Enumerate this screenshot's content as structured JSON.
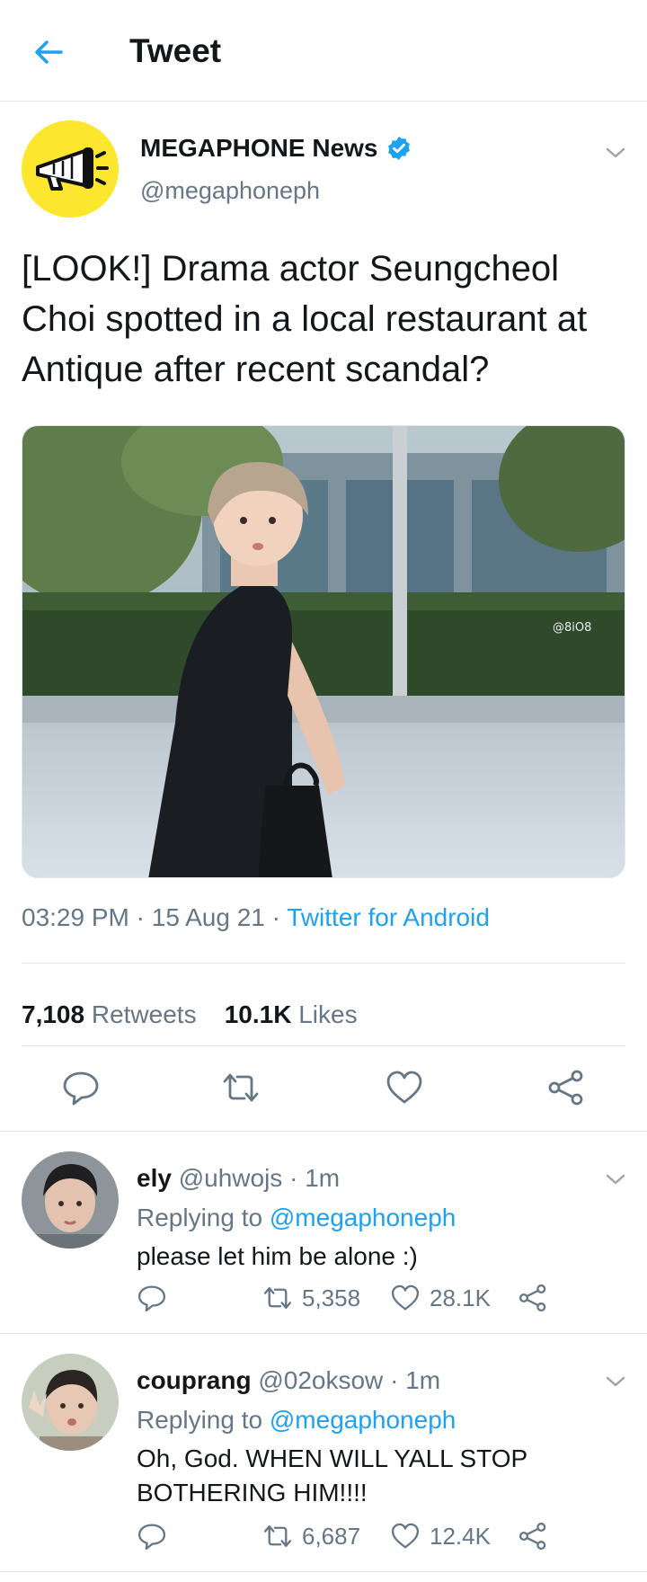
{
  "header": {
    "title": "Tweet",
    "back_icon": "arrow-left-icon"
  },
  "colors": {
    "accent": "#1da1f2",
    "muted": "#657786",
    "text": "#14171a",
    "avatar_bg": "#fde72e"
  },
  "tweet": {
    "author_name": "MEGAPHONE News",
    "author_handle": "@megaphoneph",
    "text": "[LOOK!] Drama actor Seungcheol Choi spotted in a local restaurant at Antique after recent scandal?",
    "media_watermark": "@8iO8",
    "time": "03:29 PM",
    "date": "15 Aug 21",
    "source": "Twitter for Android",
    "retweets_count": "7,108",
    "retweets_label": "Retweets",
    "likes_count": "10.1K",
    "likes_label": "Likes",
    "actions": [
      "reply-icon",
      "retweet-icon",
      "like-icon",
      "share-icon"
    ]
  },
  "replies": [
    {
      "name": "ely",
      "handle": "@uhwojs",
      "time": "1m",
      "replying_prefix": "Replying to",
      "replying_to": "@megaphoneph",
      "text": "please let him be alone :)",
      "retweets": "5,358",
      "likes": "28.1K"
    },
    {
      "name": "couprang",
      "handle": "@02oksow",
      "time": "1m",
      "replying_prefix": "Replying to",
      "replying_to": "@megaphoneph",
      "text": "Oh, God. WHEN WILL YALL STOP BOTHERING HIM!!!!",
      "retweets": "6,687",
      "likes": "12.4K"
    }
  ]
}
